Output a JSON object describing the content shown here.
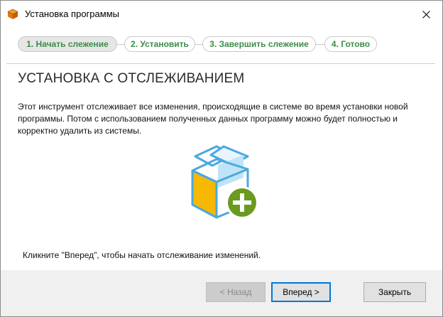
{
  "window": {
    "title": "Установка программы",
    "close_symbol": "✕"
  },
  "steps": [
    {
      "label": "1. Начать слежение",
      "state": "active"
    },
    {
      "label": "2. Установить",
      "state": "inactive"
    },
    {
      "label": "3. Завершить слежение",
      "state": "inactive"
    },
    {
      "label": "4. Готово",
      "state": "inactive"
    }
  ],
  "main": {
    "heading": "УСТАНОВКА С ОТСЛЕЖИВАНИЕМ",
    "description": "Этот инструмент отслеживает все изменения, происходящие в системе во время установки новой программы. Потом с использованием полученных данных программу можно будет полностью и корректно удалить из системы.",
    "illustration_icon": "box-with-plus-icon",
    "hint": "Кликните \"Вперед\", чтобы начать отслеживание изменений."
  },
  "footer": {
    "back_label": "< Назад",
    "back_enabled": false,
    "next_label": "Вперед >",
    "cancel_label": "Закрыть"
  },
  "colors": {
    "step_text": "#3d8c4a",
    "focus_border": "#0078d7",
    "plus_circle": "#6a9a1f",
    "box_yellow": "#f6b800",
    "box_blue": "#4aa8e0"
  }
}
